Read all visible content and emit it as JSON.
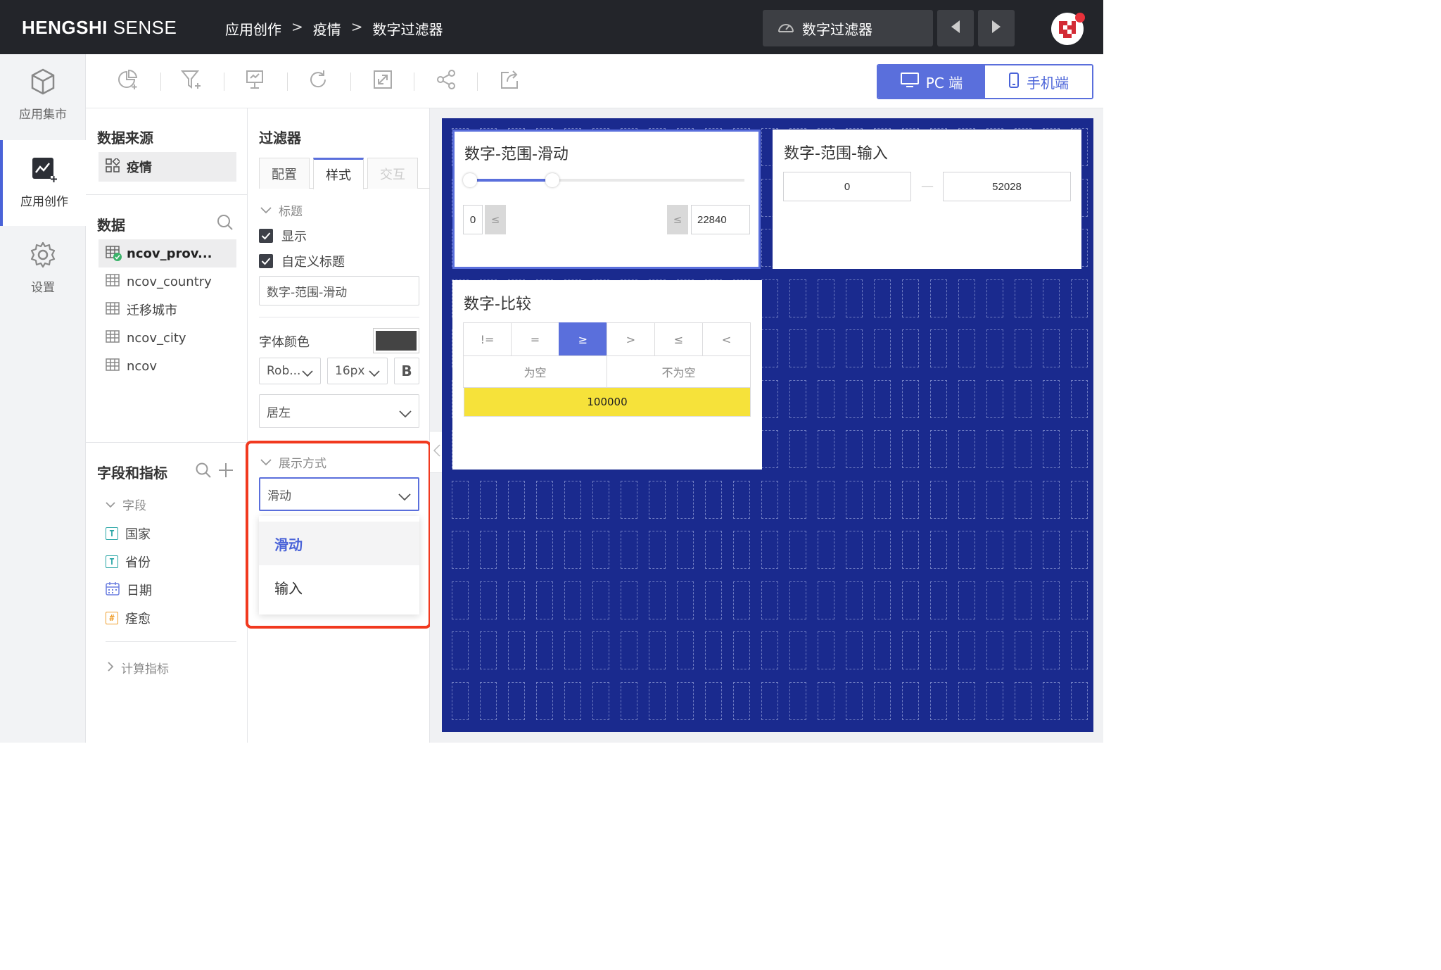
{
  "header": {
    "brand_bold": "HENGSHI",
    "brand_rest": " SENSE",
    "breadcrumb": [
      "应用创作",
      "疫情",
      "数字过滤器"
    ],
    "breadcrumb_sep": ">",
    "dashboard_name": "数字过滤器",
    "icons": [
      "dashboard-gauge-icon",
      "prev-arrow-icon",
      "next-arrow-icon",
      "user-avatar"
    ]
  },
  "rail": {
    "items": [
      {
        "label": "应用集市",
        "icon": "cube-icon"
      },
      {
        "label": "应用创作",
        "icon": "chart-create-icon"
      },
      {
        "label": "设置",
        "icon": "gear-icon"
      }
    ]
  },
  "toolbar": {
    "tools": [
      "add-chart-icon",
      "add-filter-icon",
      "add-presentation-icon",
      "refresh-icon",
      "fullscreen-icon",
      "share-icon",
      "export-icon"
    ],
    "device_pc": "PC 端",
    "device_mobile": "手机端"
  },
  "data_panel": {
    "source_title": "数据来源",
    "source_name": "疫情",
    "data_title": "数据",
    "datasets": [
      "ncov_prov...",
      "ncov_country",
      "迁移城市",
      "ncov_city",
      "ncov"
    ],
    "fields_title": "字段和指标",
    "fields_group": "字段",
    "fields": [
      {
        "name": "国家",
        "type": "T"
      },
      {
        "name": "省份",
        "type": "T"
      },
      {
        "name": "日期",
        "type": "date"
      },
      {
        "name": "痊愈",
        "type": "#"
      }
    ],
    "calc_group": "计算指标"
  },
  "filter_panel": {
    "title": "过滤器",
    "tabs": [
      "配置",
      "样式",
      "交互"
    ],
    "title_section": "标题",
    "show_label": "显示",
    "custom_title_label": "自定义标题",
    "custom_title_value": "数字-范围-滑动",
    "font_color_label": "字体颜色",
    "font_color": "#444444",
    "font_family": "Rob...",
    "font_size": "16px",
    "bold_label": "B",
    "align": "居左",
    "display_section": "展示方式",
    "display_value": "滑动",
    "display_options": [
      "滑动",
      "输入"
    ]
  },
  "canvas": {
    "bg_color": "#1a2a8e",
    "slider_card": {
      "title": "数字-范围-滑动",
      "min": "0",
      "max": "22840",
      "le_symbol": "≤",
      "slider_range": [
        0.0,
        0.3
      ]
    },
    "input_card": {
      "title": "数字-范围-输入",
      "min": "0",
      "max": "52028",
      "dash": "—"
    },
    "compare_card": {
      "title": "数字-比较",
      "operators": [
        "!=",
        "=",
        "≥",
        ">",
        "≤",
        "<"
      ],
      "active_operator_index": 2,
      "null_options": [
        "为空",
        "不为空"
      ],
      "value": "100000",
      "value_bg": "#f6e23a"
    }
  }
}
